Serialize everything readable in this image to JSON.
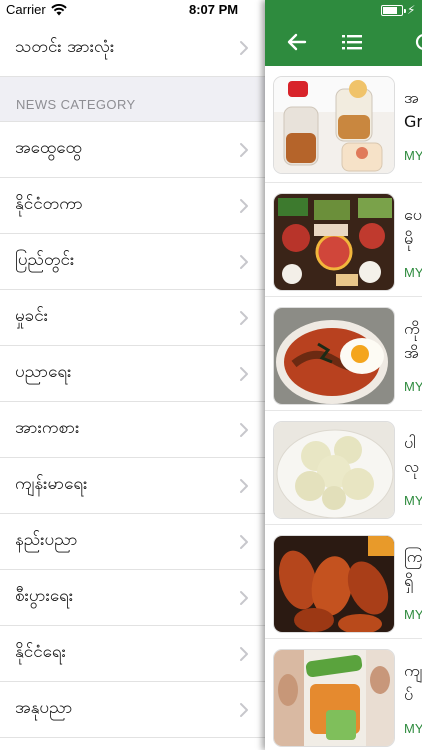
{
  "status_bar": {
    "carrier": "Carrier",
    "time": "8:07 PM",
    "bolt": "⚡"
  },
  "drawer": {
    "top_item": "သတင်း အားလုံး",
    "section_title": "NEWS CATEGORY",
    "categories": [
      "အထွေထွေ",
      "နိုင်ငံတကာ",
      "ပြည်တွင်း",
      "မှုခင်း",
      "ပညာရေး",
      "အားကစား",
      "ကျန်းမာရေး",
      "နည်းပညာ",
      "စီးပွားရေး",
      "နိုင်ငံရေး",
      "အနုပညာ"
    ]
  },
  "main": {
    "icons": [
      "back-arrow-icon",
      "list-icon",
      "more-icon"
    ],
    "accent": "#2e8b3e",
    "news": [
      {
        "title": "အ\nGr",
        "source": "MY",
        "thumb": "tea-jars"
      },
      {
        "title": "ပေ\nမို",
        "source": "MY",
        "thumb": "hotpot-table"
      },
      {
        "title": "ကို\nအိ",
        "source": "MY",
        "thumb": "rice-bowl-egg"
      },
      {
        "title": "ပါ\nလု",
        "source": "MY",
        "thumb": "ice-cream"
      },
      {
        "title": "ကြ\nရှိ",
        "source": "MY",
        "thumb": "chicken-wings"
      },
      {
        "title": "ကျ\nပ်",
        "source": "MY",
        "thumb": "aloe-vera"
      }
    ]
  }
}
